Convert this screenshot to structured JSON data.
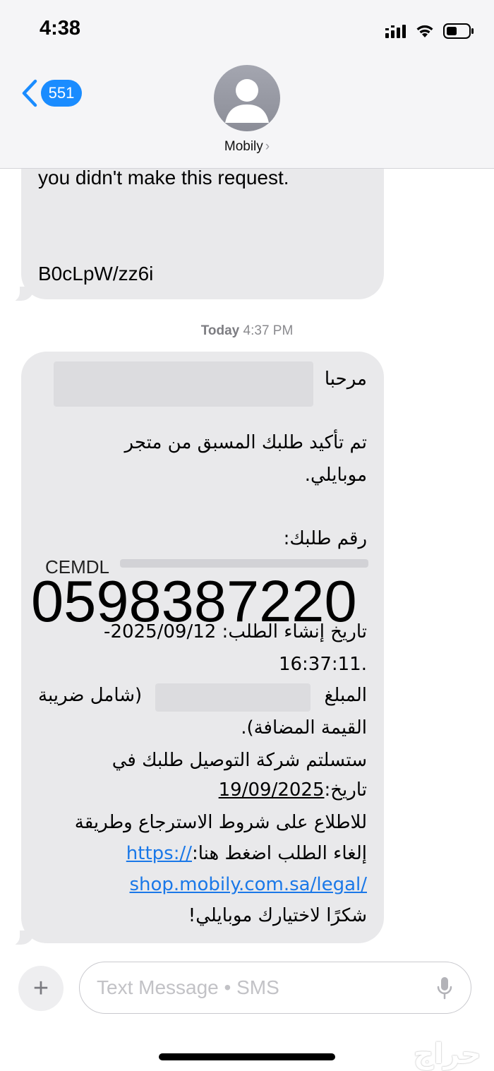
{
  "status_bar": {
    "time": "4:38"
  },
  "header": {
    "back_count": "551",
    "contact_name": "Mobily",
    "chevron": "›"
  },
  "messages": {
    "previous": {
      "line1": "you didn't make this request.",
      "code": "B0cLpW/zz6i"
    },
    "timestamp_day": "Today",
    "timestamp_time": "4:37 PM",
    "current": {
      "greeting": "مرحبا",
      "confirm_line1": "تم تأكيد طلبك المسبق من متجر",
      "confirm_line2": "موبايلي.",
      "order_label": "رقم طلبك:",
      "order_partial": "CEMDL",
      "created_line1": "تاريخ إنشاء الطلب: 2025/09/12-",
      "created_line2": ".16:37:11",
      "amount_label": "المبلغ",
      "amount_suffix": "(شامل ضريبة",
      "vat_line": "القيمة المضافة).",
      "delivery_line1": "ستسلتم شركة التوصيل طلبك في",
      "delivery_label": "تاريخ:",
      "delivery_date": "19/09/2025",
      "terms_line1": "للاطلاع على شروط الاسترجاع وطريقة",
      "terms_line2": "إلغاء الطلب اضغط هنا:",
      "link_part1": "https://",
      "link_part2": "shop.mobily.com.sa/legal/",
      "thanks": "شكرًا لاختيارك موبايلي!"
    },
    "overlay_phone": "0598387220"
  },
  "composer": {
    "plus": "+",
    "placeholder": "Text Message • SMS"
  },
  "watermark": "حراج",
  "icons": {
    "back": "chevron-left-icon",
    "avatar": "person-icon",
    "mic": "microphone-icon",
    "signal": "cellular-signal-icon",
    "wifi": "wifi-icon",
    "battery": "battery-icon"
  },
  "colors": {
    "accent": "#1a8cff",
    "bubble": "#e9e9eb",
    "link": "#1a78e8"
  }
}
